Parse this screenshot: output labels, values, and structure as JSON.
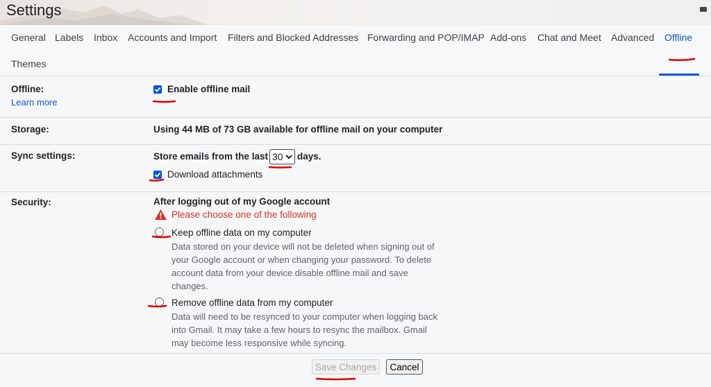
{
  "app": {
    "title": "Settings"
  },
  "tabs": [
    {
      "label": "General"
    },
    {
      "label": "Labels"
    },
    {
      "label": "Inbox"
    },
    {
      "label": "Accounts and Import"
    },
    {
      "label": "Filters and Blocked Addresses"
    },
    {
      "label": "Forwarding and POP/IMAP"
    },
    {
      "label": "Add-ons"
    },
    {
      "label": "Chat and Meet"
    },
    {
      "label": "Advanced"
    },
    {
      "label": "Offline",
      "active": true
    },
    {
      "label": "Themes"
    }
  ],
  "offline": {
    "label": "Offline:",
    "learn_more": "Learn more",
    "enable_label": "Enable offline mail",
    "enabled": true
  },
  "storage": {
    "label": "Storage:",
    "text": "Using 44 MB of 73 GB available for offline mail on your computer"
  },
  "sync": {
    "label": "Sync settings:",
    "prefix": "Store emails from the last",
    "days_value": "30",
    "suffix": "days.",
    "download_label": "Download attachments",
    "download_checked": true
  },
  "security": {
    "label": "Security:",
    "heading": "After logging out of my Google account",
    "warning": "Please choose one of the following",
    "options": [
      {
        "label": "Keep offline data on my computer",
        "description": "Data stored on your device will not be deleted when signing out of your Google account or when changing your password. To delete account data from your device disable offline mail and save changes."
      },
      {
        "label": "Remove offline data from my computer",
        "description": "Data will need to be resynced to your computer when logging back into Gmail. It may take a few hours to resync the mailbox. Gmail may become less responsive while syncing."
      }
    ]
  },
  "footer": {
    "save_label": "Save Changes",
    "cancel_label": "Cancel"
  },
  "colors": {
    "accent": "#0b57d0",
    "warning": "#d93025",
    "annotation": "#e00000"
  }
}
